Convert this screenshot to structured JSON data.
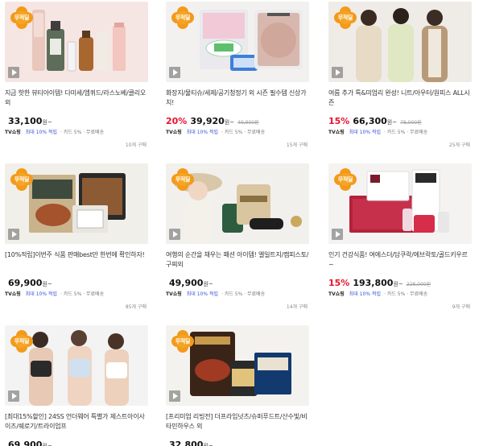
{
  "colors": {
    "badge": "#f39a1b",
    "accent_red": "#e8122d",
    "benefit_blue": "#3b4fd9"
  },
  "products": [
    {
      "badge": "무적딜",
      "title": "지금 핫한 뷰티아이템! 다미세/엠퀴드/라스노베/클리오 외",
      "rate": "",
      "price": "33,100",
      "won": "원~",
      "orig": "",
      "channel": "TV쇼핑",
      "benefit": "최대 10% 적립",
      "meta": "· 카드 5% · 무료배송",
      "count": "10개 구매"
    },
    {
      "badge": "무적딜",
      "title": "화장지/물티슈/세제/공기청정기 외 시즌 필수템 신상가치!",
      "rate": "20%",
      "price": "39,920",
      "won": "원~",
      "orig": "49,900원",
      "channel": "TV쇼핑",
      "benefit": "최대 10% 적립",
      "meta": "· 카드 5% · 무료배송",
      "count": "15개 구매"
    },
    {
      "badge": "무적딜",
      "title": "여름 추가 특&미엄리 완성! 니트/아우터/원피스 ALL시즌",
      "rate": "15%",
      "price": "66,300",
      "won": "원~",
      "orig": "78,000원",
      "channel": "TV쇼핑",
      "benefit": "최대 10% 적립",
      "meta": "· 카드 5% · 무료배송",
      "count": "25개 구매"
    },
    {
      "badge": "무적딜",
      "title": "[10%적립]이번주 식품 판매best만 한번에 확인하자!",
      "rate": "",
      "price": "69,900",
      "won": "원~",
      "orig": "",
      "channel": "TV쇼핑",
      "benefit": "최대 10% 적립",
      "meta": "· 카드 5% · 무료배송",
      "count": "85개 구매"
    },
    {
      "badge": "무적딜",
      "title": "여행의 순간을 채우는 패션 아이템! 엘일트지/캠피스토/구찌외",
      "rate": "",
      "price": "49,900",
      "won": "원~",
      "orig": "",
      "channel": "TV쇼핑",
      "benefit": "최대 10% 적립",
      "meta": "· 카드 5% · 무료배송",
      "count": "14개 구매"
    },
    {
      "badge": "무적딜",
      "title": "인기 건강식품! 여에스더/담쿠락/에브락토/골드키우르 ~",
      "rate": "15%",
      "price": "193,800",
      "won": "원~",
      "orig": "228,000원",
      "channel": "TV쇼핑",
      "benefit": "최대 10% 적립",
      "meta": "· 카드 5% · 무료배송",
      "count": "9개 구매"
    },
    {
      "badge": "무적딜",
      "title": "[최대15%할인] 24SS 언더웨어 특별가 제스트아이사이즈/쉐로기/트라이엄프",
      "rate": "",
      "price": "69,900",
      "won": "원~",
      "orig": "",
      "channel": "",
      "benefit": "",
      "meta": "",
      "count": ""
    },
    {
      "badge": "무적딜",
      "title": "[프리미엄 리빙전] 더프라임넛츠/슈퍼푸드트/산수빛/비타민하우스 외",
      "rate": "",
      "price": "32,800",
      "won": "원~",
      "orig": "",
      "channel": "",
      "benefit": "",
      "meta": "",
      "count": ""
    }
  ]
}
